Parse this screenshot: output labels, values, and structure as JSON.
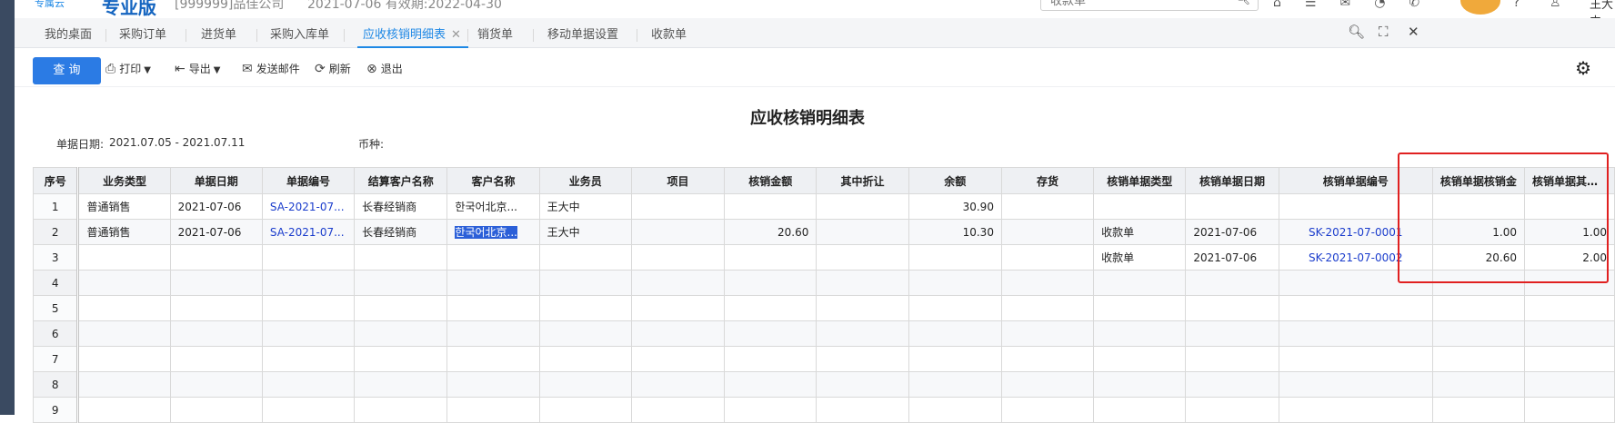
{
  "topbar": {
    "brand": "专属云",
    "product": "专业版",
    "company": "[999999]品佳公司",
    "dates": "2021-07-06  有效期:2022-04-30",
    "search_placeholder": "收款单",
    "user": "王大中"
  },
  "tabs": [
    {
      "label": "我的桌面",
      "active": false
    },
    {
      "label": "采购订单",
      "active": false
    },
    {
      "label": "进货单",
      "active": false
    },
    {
      "label": "采购入库单",
      "active": false
    },
    {
      "label": "应收核销明细表",
      "active": true
    },
    {
      "label": "销货单",
      "active": false
    },
    {
      "label": "移动单据设置",
      "active": false
    },
    {
      "label": "收款单",
      "active": false
    }
  ],
  "tab_close_glyph": "✕",
  "toolbar": {
    "query": "查 询",
    "print": "打印",
    "export": "导出",
    "email": "发送邮件",
    "refresh": "刷新",
    "exit": "退出"
  },
  "report": {
    "title": "应收核销明细表",
    "date_label": "单据日期:",
    "date_range": "2021.07.05 - 2021.07.11",
    "currency_label": "币种:"
  },
  "table": {
    "columns": [
      "序号",
      "业务类型",
      "单据日期",
      "单据编号",
      "结算客户名称",
      "客户名称",
      "业务员",
      "项目",
      "核销金额",
      "其中折让",
      "余额",
      "存货",
      "核销单据类型",
      "核销单据日期",
      "核销单据编号",
      "核销单据核销金",
      "核销单据其中折"
    ],
    "rows": [
      {
        "idx": "1",
        "type": "普通销售",
        "date": "2021-07-06",
        "no": "SA-2021-07...",
        "settle": "长春经销商",
        "customer": "한국어北京...",
        "staff": "王大中",
        "project": "",
        "amount": "",
        "discount": "",
        "balance": "30.90",
        "stock": "",
        "vtype": "",
        "vdate": "",
        "vno": "",
        "vamount": "",
        "vdiscount": ""
      },
      {
        "idx": "2",
        "type": "普通销售",
        "date": "2021-07-06",
        "no": "SA-2021-07...",
        "settle": "长春经销商",
        "customer": "한국어北京...",
        "staff": "王大中",
        "project": "",
        "amount": "20.60",
        "discount": "",
        "balance": "10.30",
        "stock": "",
        "vtype": "收款单",
        "vdate": "2021-07-06",
        "vno": "SK-2021-07-0001",
        "vamount": "1.00",
        "vdiscount": "1.00"
      },
      {
        "idx": "3",
        "type": "",
        "date": "",
        "no": "",
        "settle": "",
        "customer": "",
        "staff": "",
        "project": "",
        "amount": "",
        "discount": "",
        "balance": "",
        "stock": "",
        "vtype": "收款单",
        "vdate": "2021-07-06",
        "vno": "SK-2021-07-0002",
        "vamount": "20.60",
        "vdiscount": "2.00"
      },
      {
        "idx": "4"
      },
      {
        "idx": "5"
      },
      {
        "idx": "6"
      },
      {
        "idx": "7"
      },
      {
        "idx": "8"
      },
      {
        "idx": "9"
      }
    ]
  }
}
